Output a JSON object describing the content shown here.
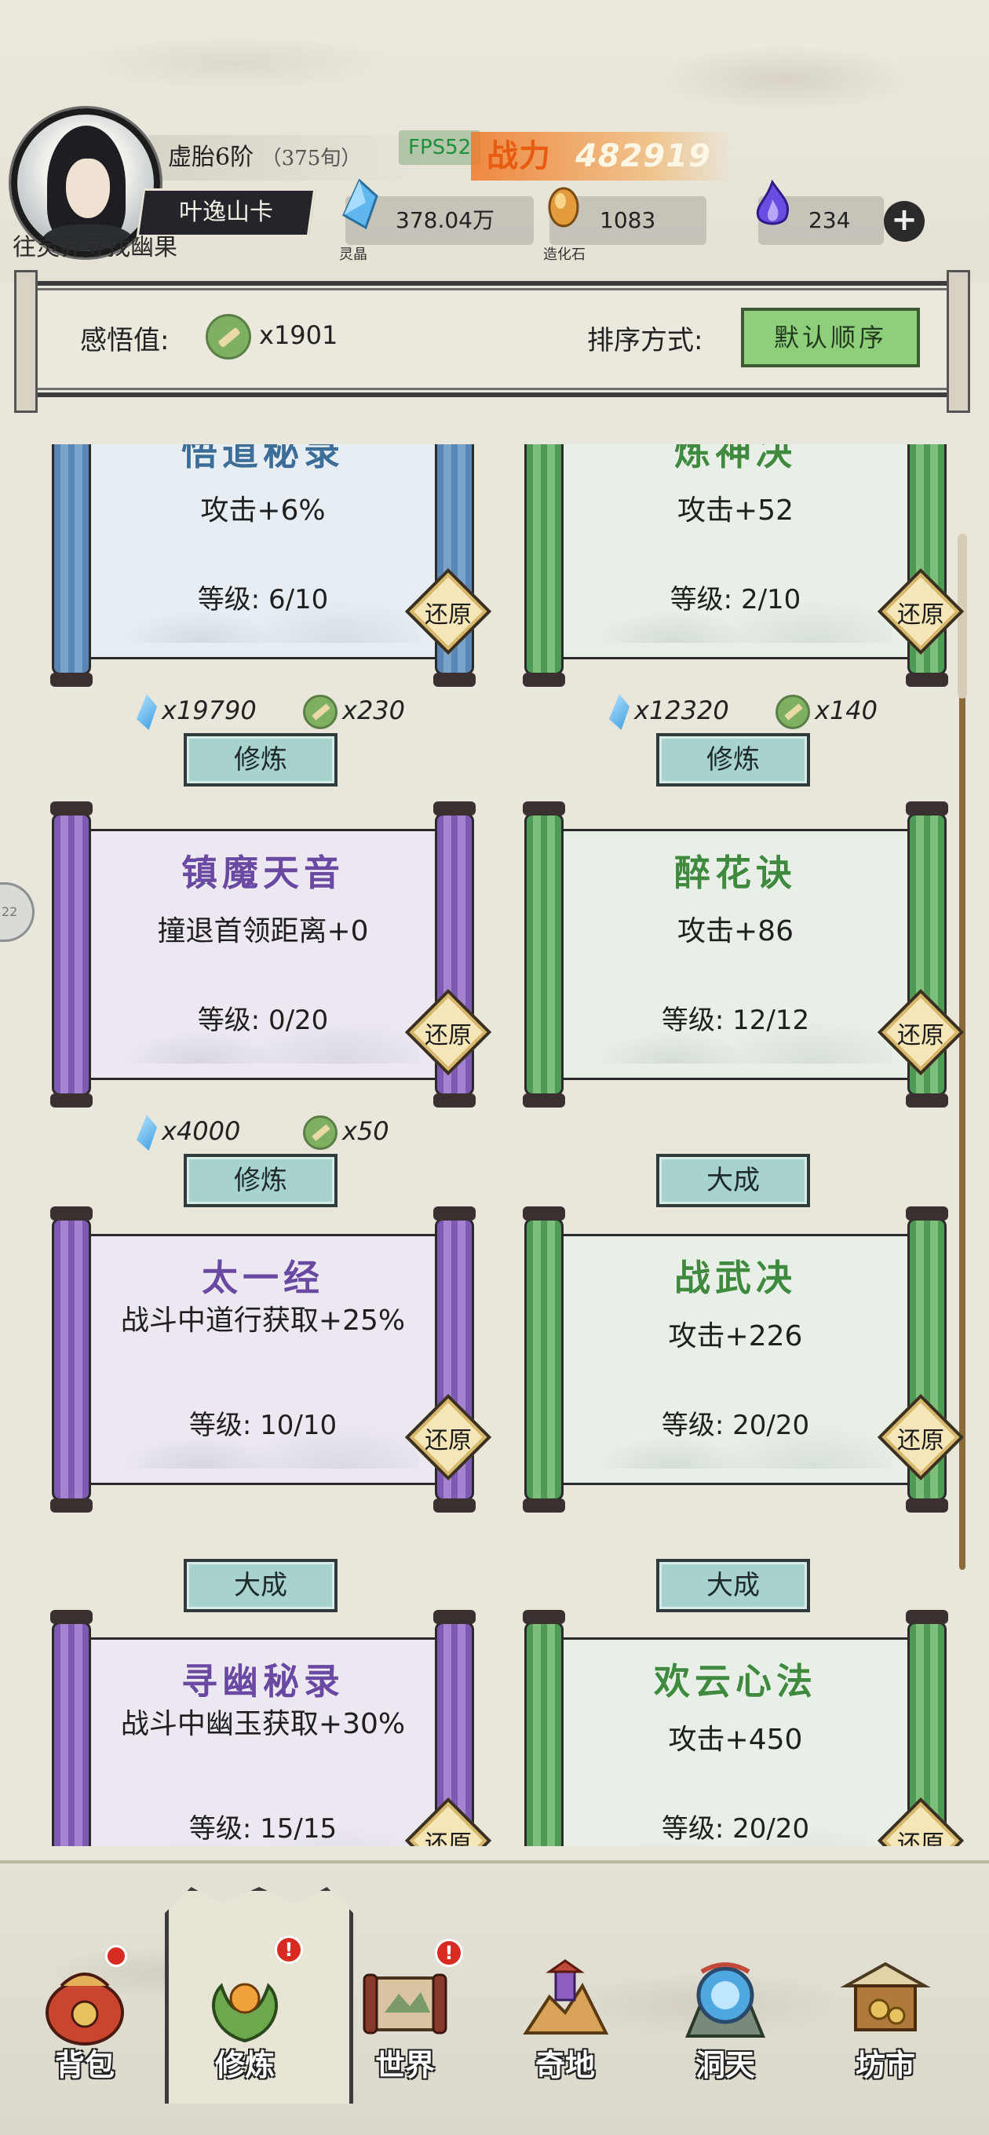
{
  "header": {
    "realm": "虚胎6阶",
    "age": "（375旬）",
    "player_name": "叶逸山卡",
    "quest_text": "往灵界寻找幽果",
    "fps": "FPS52",
    "power_label": "战力",
    "power_value": "482919",
    "resources": [
      {
        "icon": "spirit-crystal-icon",
        "caption": "灵晶",
        "value": "378.04万"
      },
      {
        "icon": "creation-stone-icon",
        "caption": "造化石",
        "value": "1083"
      },
      {
        "icon": "purple-flame-icon",
        "caption": "",
        "value": "234"
      }
    ],
    "plus_label": "+"
  },
  "info": {
    "insight_label": "感悟值:",
    "insight_value": "x1901",
    "sort_label": "排序方式:",
    "sort_button": "默认顺序"
  },
  "side_tab": "22",
  "cards": [
    {
      "title": "悟道秘录",
      "effect": "攻击+6%",
      "level": "等级: 6/10",
      "restore": "还原",
      "color": "blue",
      "cost_crystal": "x19790",
      "cost_scroll": "x230",
      "action": "修炼"
    },
    {
      "title": "炼神决",
      "effect": "攻击+52",
      "level": "等级: 2/10",
      "restore": "还原",
      "color": "green",
      "cost_crystal": "x12320",
      "cost_scroll": "x140",
      "action": "修炼"
    },
    {
      "title": "镇魔天音",
      "effect": "撞退首领距离+0",
      "level": "等级: 0/20",
      "restore": "还原",
      "color": "purple",
      "cost_crystal": "x4000",
      "cost_scroll": "x50",
      "action": "修炼"
    },
    {
      "title": "醉花诀",
      "effect": "攻击+86",
      "level": "等级: 12/12",
      "restore": "还原",
      "color": "green",
      "cost_crystal": "",
      "cost_scroll": "",
      "action": "大成"
    },
    {
      "title": "太一经",
      "effect": "战斗中道行获取+25%",
      "level": "等级: 10/10",
      "restore": "还原",
      "color": "purple",
      "cost_crystal": "",
      "cost_scroll": "",
      "action": "大成"
    },
    {
      "title": "战武决",
      "effect": "攻击+226",
      "level": "等级: 20/20",
      "restore": "还原",
      "color": "green",
      "cost_crystal": "",
      "cost_scroll": "",
      "action": "大成"
    },
    {
      "title": "寻幽秘录",
      "effect": "战斗中幽玉获取+30%",
      "level": "等级: 15/15",
      "restore": "还原",
      "color": "purple",
      "cost_crystal": "",
      "cost_scroll": "",
      "action": ""
    },
    {
      "title": "欢云心法",
      "effect": "攻击+450",
      "level": "等级: 20/20",
      "restore": "还原",
      "color": "green",
      "cost_crystal": "",
      "cost_scroll": "",
      "action": ""
    }
  ],
  "nav": [
    {
      "label": "背包",
      "icon": "bag-icon",
      "badge": ""
    },
    {
      "label": "修炼",
      "icon": "cultivation-icon",
      "badge": "!"
    },
    {
      "label": "世界",
      "icon": "world-map-icon",
      "badge": "!"
    },
    {
      "label": "奇地",
      "icon": "wonderland-icon",
      "badge": ""
    },
    {
      "label": "洞天",
      "icon": "cave-portal-icon",
      "badge": ""
    },
    {
      "label": "坊市",
      "icon": "market-icon",
      "badge": ""
    }
  ],
  "colors": {
    "accent_green": "#8fcf7c",
    "power_orange": "#e85c12",
    "badge_red": "#d72a20"
  }
}
